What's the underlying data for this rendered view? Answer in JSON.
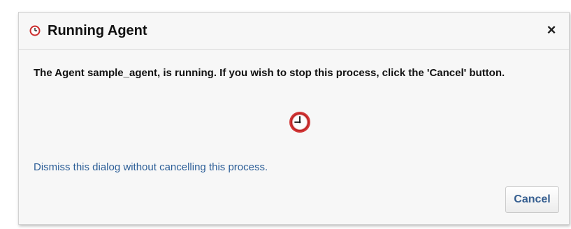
{
  "dialog": {
    "title": "Running Agent",
    "title_icon": "clock-icon",
    "close_label": "×",
    "message": "The Agent sample_agent, is running. If you wish to stop this process, click the 'Cancel' button.",
    "status_icon": "clock-icon",
    "dismiss_link": "Dismiss this dialog without cancelling this process.",
    "cancel_label": "Cancel"
  },
  "colors": {
    "link": "#2c5e97",
    "button_text": "#345d8f",
    "icon_red": "#cc2b2b",
    "dialog_background": "#f7f7f7"
  }
}
